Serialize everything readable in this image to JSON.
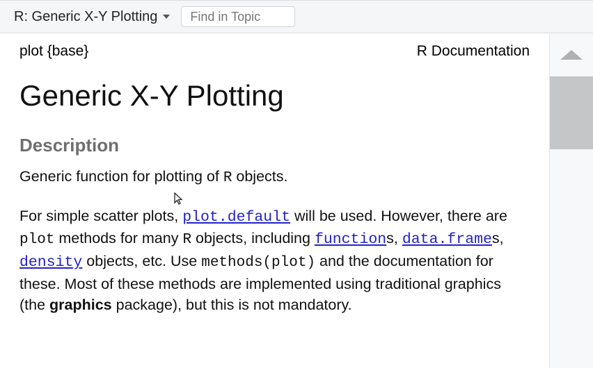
{
  "toolbar": {
    "breadcrumb": "R: Generic X-Y Plotting",
    "find_placeholder": "Find in Topic"
  },
  "header": {
    "left": "plot {base}",
    "right": "R Documentation"
  },
  "title": "Generic X-Y Plotting",
  "sections": {
    "description_heading": "Description"
  },
  "p1": {
    "t1": "Generic function for plotting of ",
    "c1": "R",
    "t2": " objects."
  },
  "p2": {
    "t1": "For simple scatter plots, ",
    "l1": "plot.default",
    "t2": " will be used. However, there are ",
    "c1": "plot",
    "t3": " methods for many ",
    "c2": "R",
    "t4": " objects, including ",
    "l2": "function",
    "t5": "s, ",
    "l3": "data.frame",
    "t6": "s, ",
    "l4": "density",
    "t7": " objects, etc. Use ",
    "c3": "methods(plot)",
    "t8": " and the documentation for these. Most of these methods are implemented using traditional graphics (the ",
    "b1": "graphics",
    "t9": " package), but this is not mandatory."
  }
}
